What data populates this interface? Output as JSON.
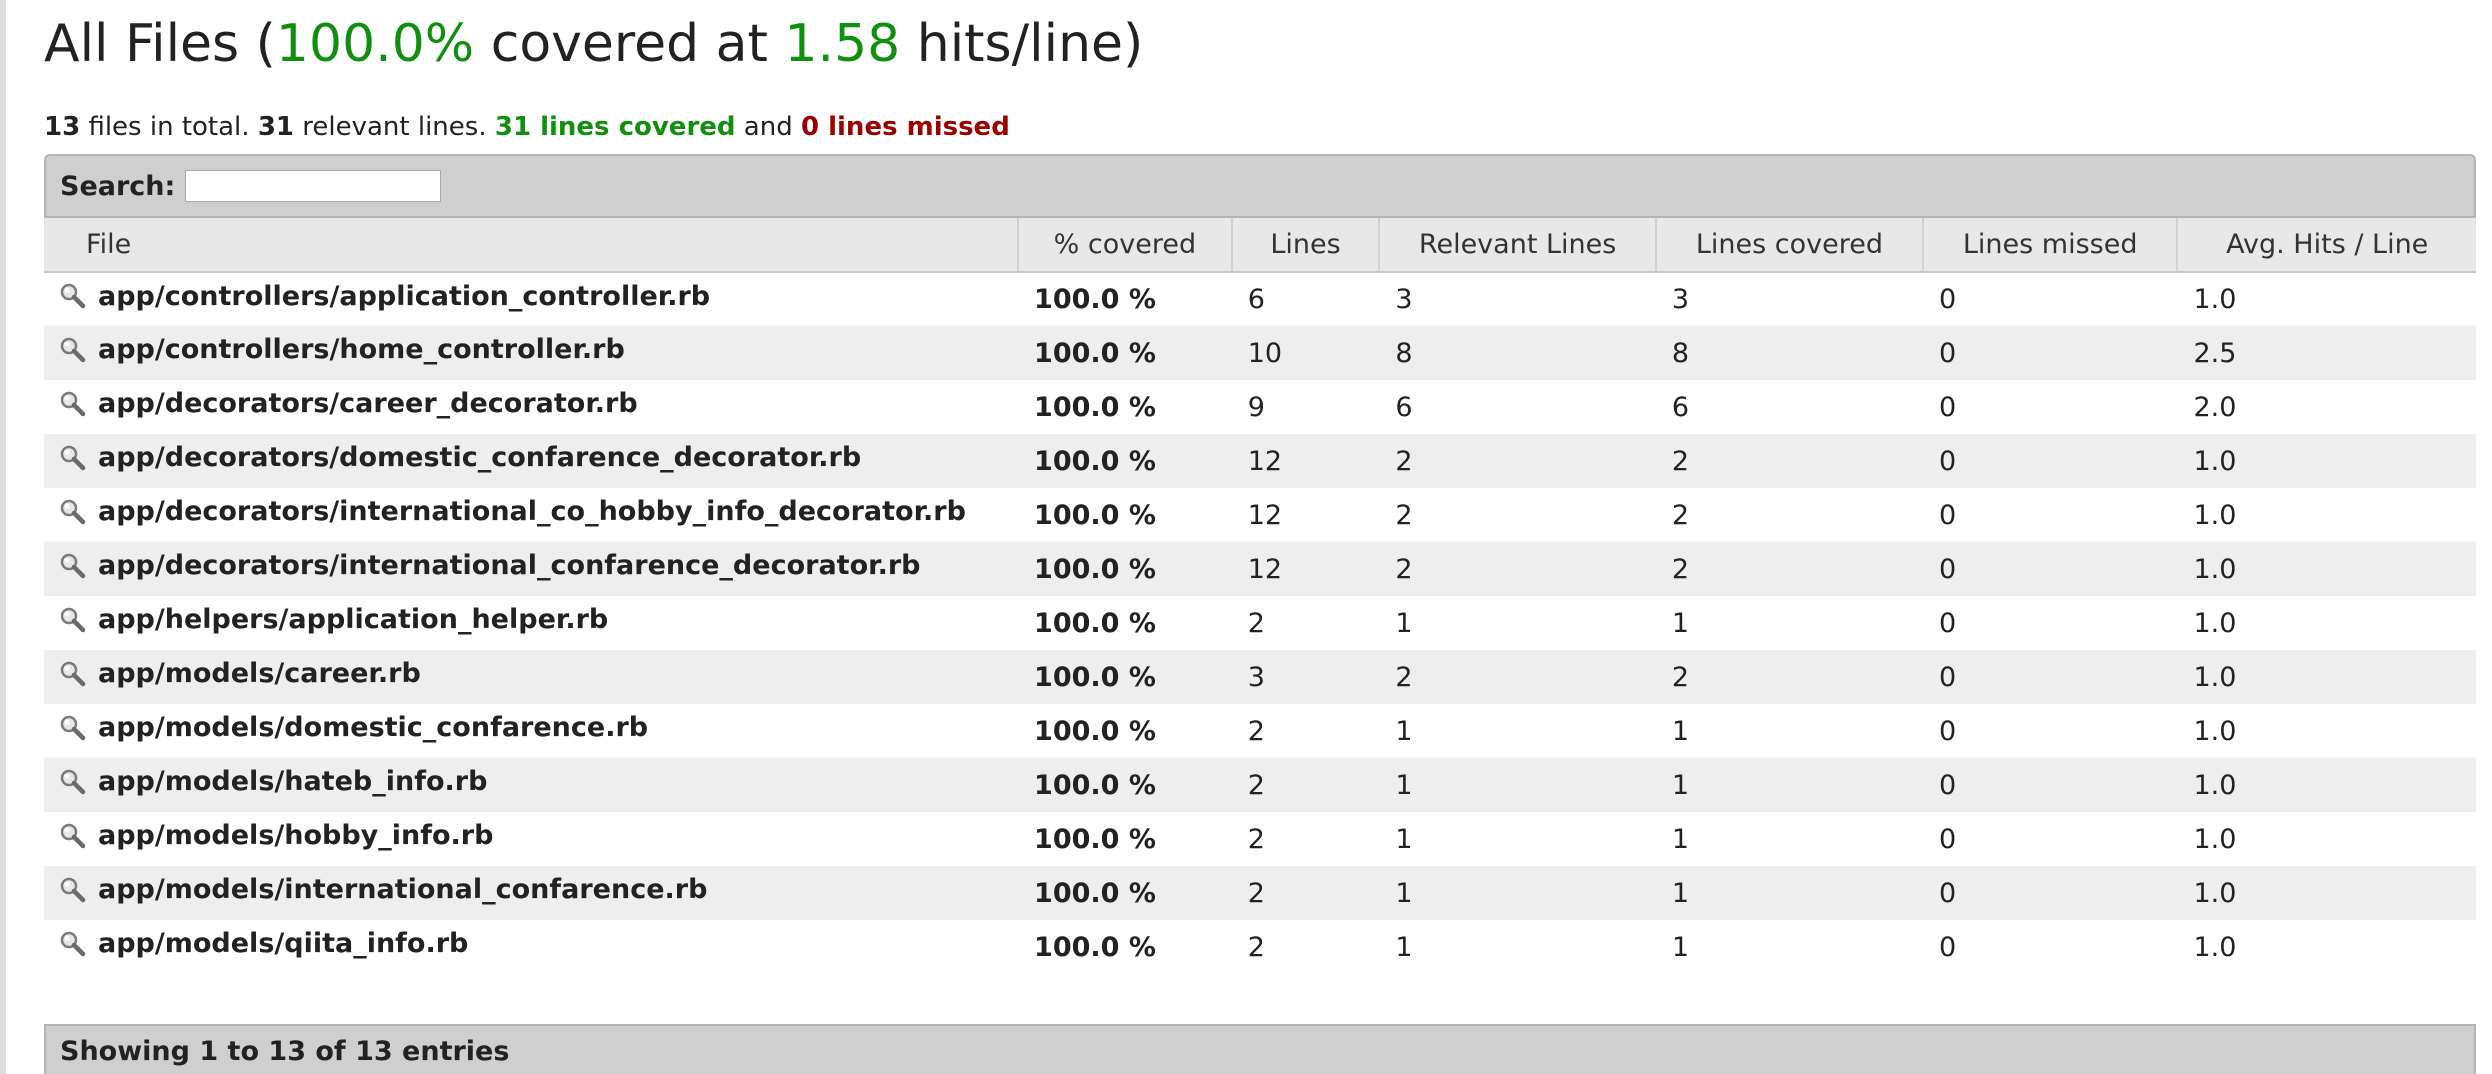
{
  "header": {
    "title_prefix": "All Files (",
    "coverage_percent": "100.0%",
    "title_middle": " covered at ",
    "hits_per_line": "1.58",
    "title_suffix": " hits/line)"
  },
  "summary": {
    "files_count": "13",
    "files_text": " files in total. ",
    "relevant_count": "31",
    "relevant_text": " relevant lines. ",
    "covered_text": "31 lines covered",
    "and_text": " and ",
    "missed_text": "0 lines missed"
  },
  "search": {
    "label": "Search:",
    "value": ""
  },
  "table": {
    "headers": [
      "File",
      "% covered",
      "Lines",
      "Relevant Lines",
      "Lines covered",
      "Lines missed",
      "Avg. Hits / Line"
    ],
    "rows": [
      {
        "file": "app/controllers/application_controller.rb",
        "covered": "100.0 %",
        "lines": "6",
        "relevant": "3",
        "lines_covered": "3",
        "missed": "0",
        "avg": "1.0"
      },
      {
        "file": "app/controllers/home_controller.rb",
        "covered": "100.0 %",
        "lines": "10",
        "relevant": "8",
        "lines_covered": "8",
        "missed": "0",
        "avg": "2.5"
      },
      {
        "file": "app/decorators/career_decorator.rb",
        "covered": "100.0 %",
        "lines": "9",
        "relevant": "6",
        "lines_covered": "6",
        "missed": "0",
        "avg": "2.0"
      },
      {
        "file": "app/decorators/domestic_confarence_decorator.rb",
        "covered": "100.0 %",
        "lines": "12",
        "relevant": "2",
        "lines_covered": "2",
        "missed": "0",
        "avg": "1.0"
      },
      {
        "file": "app/decorators/international_co_hobby_info_decorator.rb",
        "covered": "100.0 %",
        "lines": "12",
        "relevant": "2",
        "lines_covered": "2",
        "missed": "0",
        "avg": "1.0"
      },
      {
        "file": "app/decorators/international_confarence_decorator.rb",
        "covered": "100.0 %",
        "lines": "12",
        "relevant": "2",
        "lines_covered": "2",
        "missed": "0",
        "avg": "1.0"
      },
      {
        "file": "app/helpers/application_helper.rb",
        "covered": "100.0 %",
        "lines": "2",
        "relevant": "1",
        "lines_covered": "1",
        "missed": "0",
        "avg": "1.0"
      },
      {
        "file": "app/models/career.rb",
        "covered": "100.0 %",
        "lines": "3",
        "relevant": "2",
        "lines_covered": "2",
        "missed": "0",
        "avg": "1.0"
      },
      {
        "file": "app/models/domestic_confarence.rb",
        "covered": "100.0 %",
        "lines": "2",
        "relevant": "1",
        "lines_covered": "1",
        "missed": "0",
        "avg": "1.0"
      },
      {
        "file": "app/models/hateb_info.rb",
        "covered": "100.0 %",
        "lines": "2",
        "relevant": "1",
        "lines_covered": "1",
        "missed": "0",
        "avg": "1.0"
      },
      {
        "file": "app/models/hobby_info.rb",
        "covered": "100.0 %",
        "lines": "2",
        "relevant": "1",
        "lines_covered": "1",
        "missed": "0",
        "avg": "1.0"
      },
      {
        "file": "app/models/international_confarence.rb",
        "covered": "100.0 %",
        "lines": "2",
        "relevant": "1",
        "lines_covered": "1",
        "missed": "0",
        "avg": "1.0"
      },
      {
        "file": "app/models/qiita_info.rb",
        "covered": "100.0 %",
        "lines": "2",
        "relevant": "1",
        "lines_covered": "1",
        "missed": "0",
        "avg": "1.0"
      }
    ]
  },
  "footer": {
    "info": "Showing 1 to 13 of 13 entries"
  },
  "icons": {
    "row_icon": "magnifier-icon"
  },
  "colors": {
    "covered_green": "#118f11",
    "missed_red": "#9a0000",
    "bar_gray": "#cfcfcf",
    "stripe_gray": "#eeeeee"
  }
}
